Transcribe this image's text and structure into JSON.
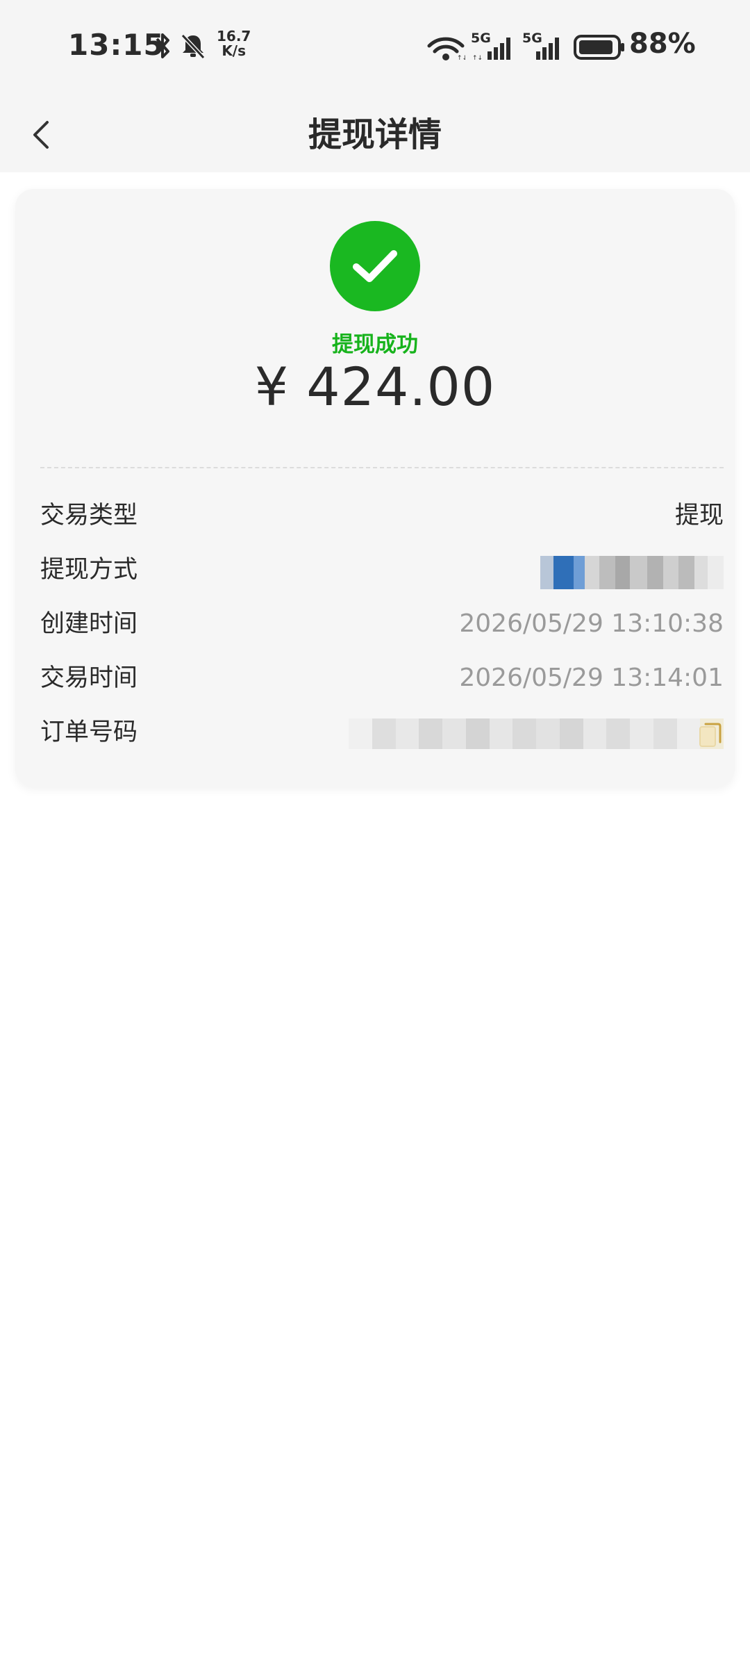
{
  "status_bar": {
    "time": "13:15",
    "net_speed_value": "16.7",
    "net_speed_unit": "K/s",
    "sim1_label": "5G",
    "sim2_label": "5G",
    "battery_percent": "88%",
    "icons": [
      "bluetooth-icon",
      "mute-bell-icon",
      "wifi-icon",
      "signal-icon",
      "battery-icon"
    ]
  },
  "nav": {
    "title": "提现详情",
    "back_icon": "chevron-left-icon"
  },
  "result": {
    "status_text": "提现成功",
    "amount": "¥ 424.00",
    "success_color": "#1ab821"
  },
  "details": {
    "type_label": "交易类型",
    "type_value": "提现",
    "method_label": "提现方式",
    "created_label": "创建时间",
    "created_value": "2026/05/29 13:10:38",
    "trade_time_label": "交易时间",
    "trade_time_value": "2026/05/29 13:14:01",
    "order_label": "订单号码"
  }
}
